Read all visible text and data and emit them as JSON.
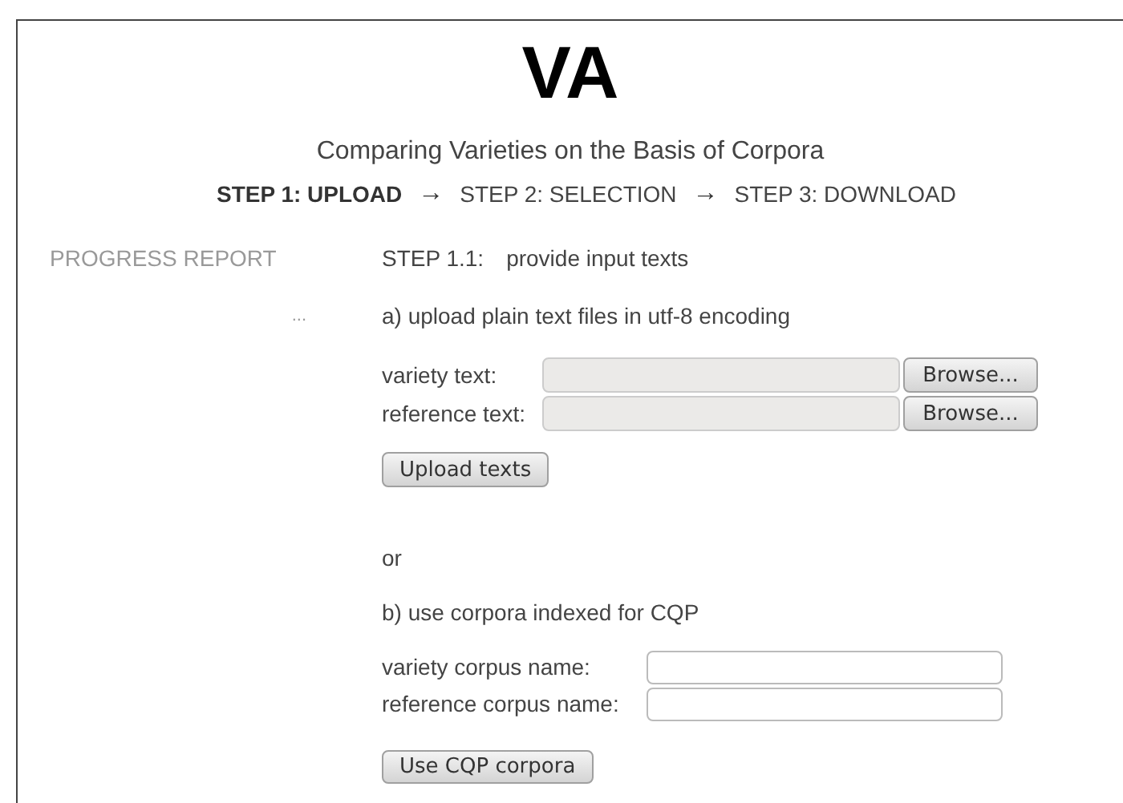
{
  "logo": "VA",
  "title": "Comparing Varieties on the Basis of Corpora",
  "steps": [
    {
      "label": "STEP 1: UPLOAD",
      "selected": true
    },
    {
      "label": "STEP 2: SELECTION",
      "selected": false
    },
    {
      "label": "STEP 3: DOWNLOAD",
      "selected": false
    }
  ],
  "step_arrow": "→",
  "progress_report": {
    "heading": "PROGRESS REPORT",
    "entry": "..."
  },
  "step_heading": {
    "number": "STEP 1.1:",
    "text": "provide input texts"
  },
  "upload_section": {
    "heading": "a) upload plain text files in utf-8 encoding",
    "fields": [
      {
        "label": "variety text:",
        "button": "Browse..."
      },
      {
        "label": "reference text:",
        "button": "Browse..."
      }
    ],
    "submit": "Upload texts"
  },
  "separator": "or",
  "cqp_section": {
    "heading": "b) use corpora indexed for CQP",
    "fields": [
      {
        "label": "variety corpus name:"
      },
      {
        "label": "reference corpus name:"
      }
    ],
    "submit": "Use CQP corpora"
  }
}
